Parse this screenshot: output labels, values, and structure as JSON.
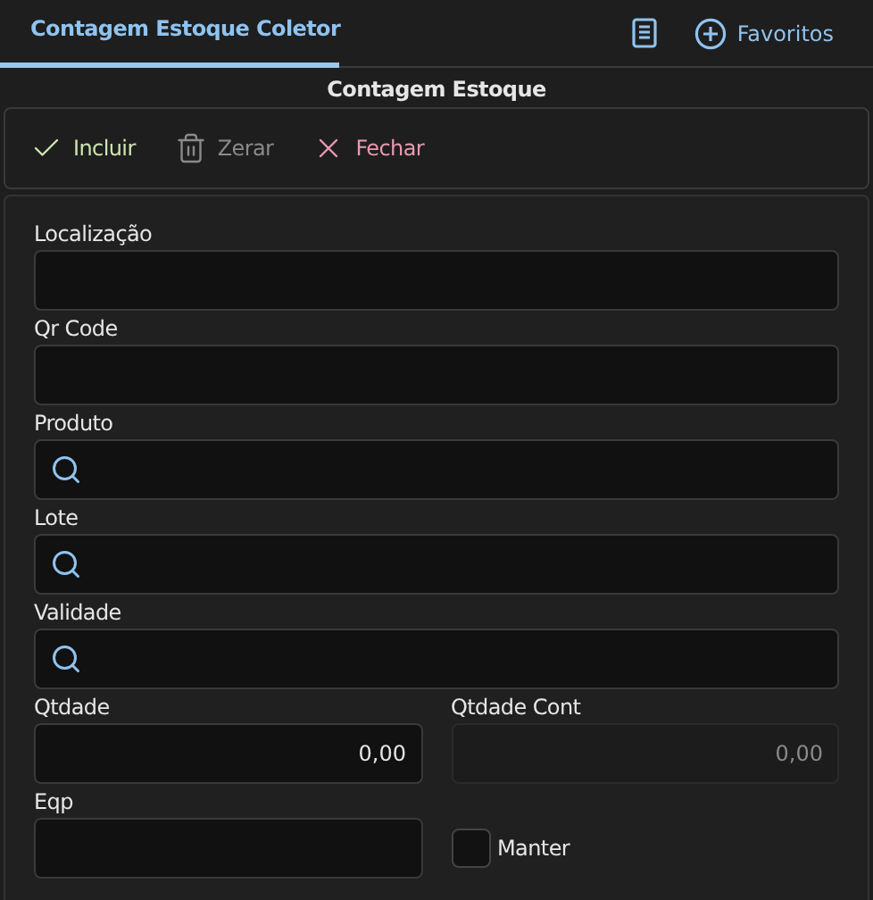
{
  "tabs": [
    {
      "label": "Contagem Estoque Coletor",
      "selected": true
    }
  ],
  "tab_actions": [
    {
      "kind": "book"
    },
    {
      "kind": "add",
      "label": "Favoritos"
    }
  ],
  "page_title": "Contagem Estoque",
  "toolbar": [
    {
      "kind": "confirm",
      "label": "Incluir",
      "disabled": false
    },
    {
      "kind": "delete",
      "label": "Zerar",
      "disabled": true
    },
    {
      "kind": "close",
      "label": "Fechar",
      "disabled": false
    }
  ],
  "form_rows": [
    [
      {
        "kind": "text",
        "label": "Localização",
        "disabled": false
      }
    ],
    [
      {
        "kind": "text",
        "label": "Qr Code",
        "disabled": false
      }
    ],
    [
      {
        "kind": "search",
        "label": "Produto",
        "disabled": false
      }
    ],
    [
      {
        "kind": "search",
        "label": "Lote",
        "disabled": false
      }
    ],
    [
      {
        "kind": "search",
        "label": "Validade",
        "disabled": false
      }
    ],
    [
      {
        "kind": "number",
        "label": "Qtdade",
        "value": "0,00",
        "disabled": false
      },
      {
        "kind": "number",
        "label": "Qtdade Cont",
        "value": "0,00",
        "disabled": true
      }
    ],
    [
      {
        "kind": "text",
        "label": "Eqp",
        "disabled": false
      },
      {
        "kind": "checkbox",
        "label": "Manter",
        "checked": false
      }
    ]
  ]
}
